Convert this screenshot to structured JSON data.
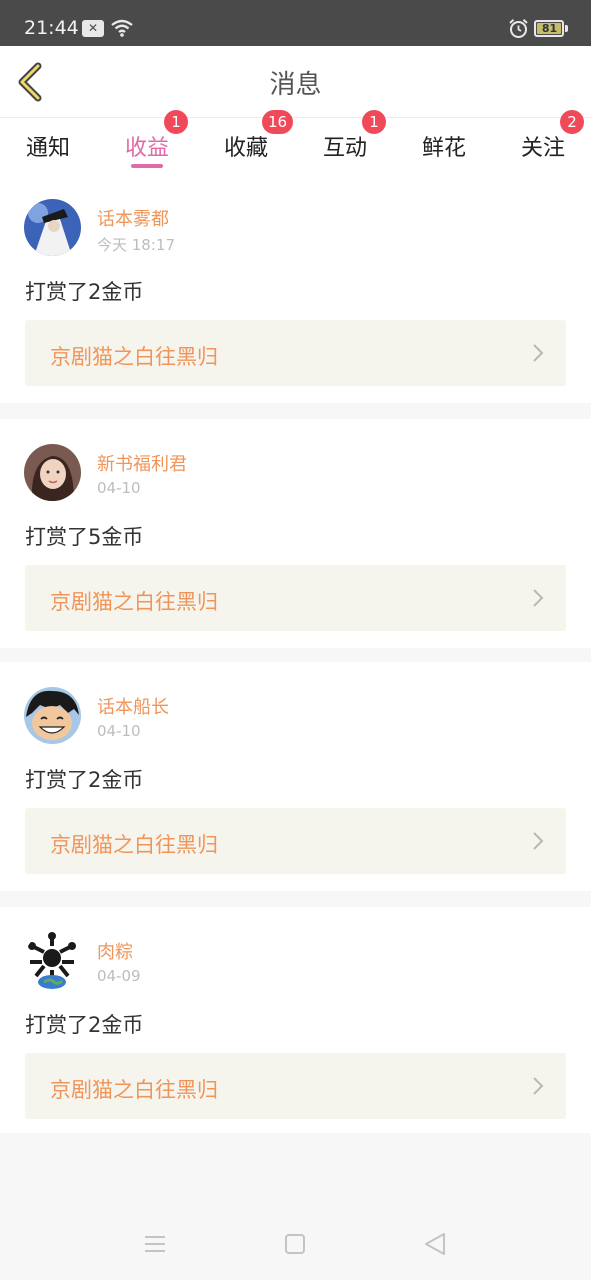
{
  "status_bar": {
    "time": "21:44",
    "battery": "81"
  },
  "header": {
    "title": "消息"
  },
  "tabs": [
    {
      "label": "通知",
      "badge": null,
      "active": false
    },
    {
      "label": "收益",
      "badge": "1",
      "active": true
    },
    {
      "label": "收藏",
      "badge": "16",
      "active": false
    },
    {
      "label": "互动",
      "badge": "1",
      "active": false
    },
    {
      "label": "鲜花",
      "badge": null,
      "active": false
    },
    {
      "label": "关注",
      "badge": "2",
      "active": false
    }
  ],
  "messages": [
    {
      "user": "话本雾都",
      "date": "今天 18:17",
      "text": "打赏了2金币",
      "book": "京剧猫之白往黑归"
    },
    {
      "user": "新书福利君",
      "date": "04-10",
      "text": "打赏了5金币",
      "book": "京剧猫之白往黑归"
    },
    {
      "user": "话本船长",
      "date": "04-10",
      "text": "打赏了2金币",
      "book": "京剧猫之白往黑归"
    },
    {
      "user": "肉粽",
      "date": "04-09",
      "text": "打赏了2金币",
      "book": "京剧猫之白往黑归"
    }
  ],
  "colors": {
    "accent": "#e06ba8",
    "name": "#f0955a",
    "badge": "#f04a5a",
    "book_bg": "#f5f5ee"
  },
  "icons": [
    "back-chevron-icon",
    "chevron-right-icon",
    "wifi-icon",
    "alarm-icon",
    "battery-icon",
    "menu-icon",
    "home-icon",
    "back-triangle-icon"
  ]
}
